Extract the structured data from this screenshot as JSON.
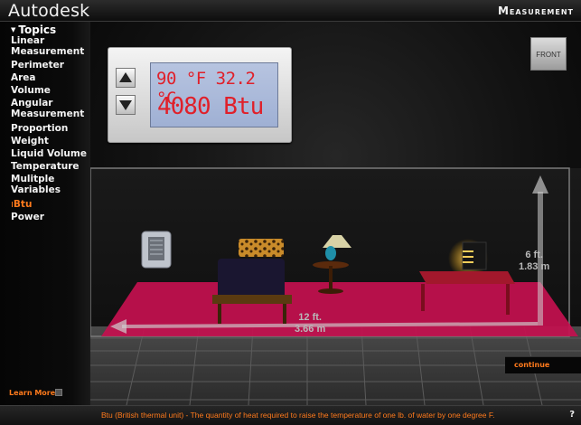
{
  "header": {
    "brand": "Autodesk",
    "title": "Measurement"
  },
  "sidebar": {
    "heading": "Topics",
    "items": [
      {
        "label": "Linear Measurement"
      },
      {
        "label": "Perimeter"
      },
      {
        "label": "Area"
      },
      {
        "label": "Volume"
      },
      {
        "label": "Angular Measurement"
      },
      {
        "label": "Proportion"
      },
      {
        "label": "Weight"
      },
      {
        "label": "Liquid Volume"
      },
      {
        "label": "Temperature"
      },
      {
        "label": "Mulitple Variables"
      },
      {
        "label": "Btu",
        "active": true
      },
      {
        "label": "Power"
      }
    ],
    "learn_more": "Learn More"
  },
  "thermostat": {
    "temperature": "90 °F  32.2 °C",
    "energy": "4080 Btu"
  },
  "view_button": "FRONT",
  "dimensions": {
    "height": {
      "ft": "6 ft.",
      "m": "1.83 m"
    },
    "length": {
      "ft": "12 ft.",
      "m": "3.66 m"
    }
  },
  "continue_label": "continue",
  "footer": {
    "definition": "Btu (British thermal unit) - The quantity of heat required to raise the temperature of one lb. of water by one degree F.",
    "help": "?"
  },
  "colors": {
    "accent": "#ff7a1c",
    "lcd_text": "#e0202a",
    "rug": "#c4104f"
  }
}
